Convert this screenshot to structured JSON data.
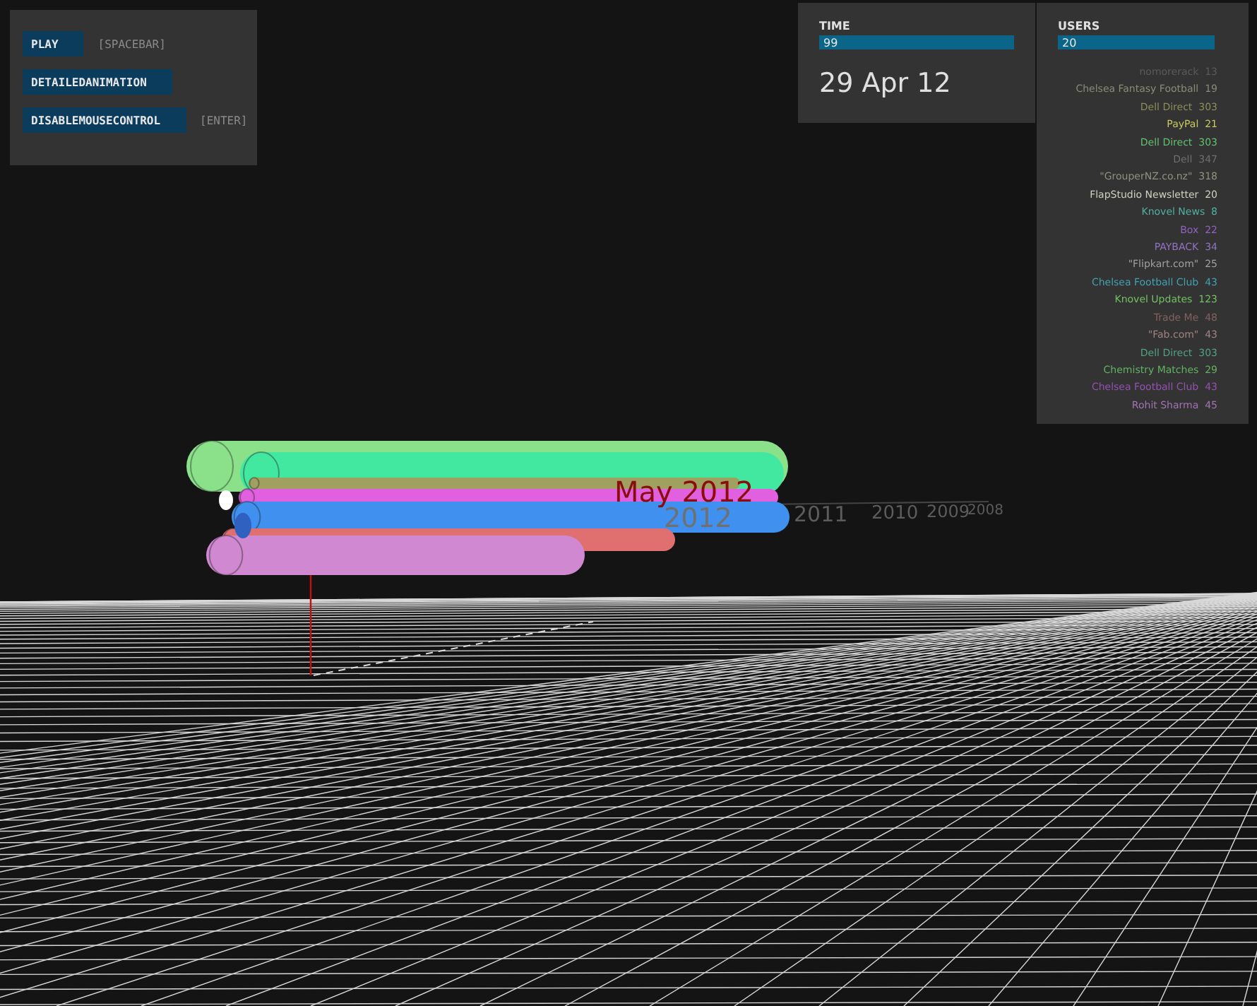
{
  "controls": [
    {
      "label": "PLAY",
      "shortcut": "[SPACEBAR]"
    },
    {
      "label": "DETAILEDANIMATION"
    },
    {
      "label": "DISABLEMOUSECONTROL",
      "shortcut": "[ENTER]"
    }
  ],
  "time": {
    "title": "TIME",
    "value": "99",
    "level": 1,
    "date": "29 Apr 12"
  },
  "users": {
    "title": "USERS",
    "value": "20",
    "level": 1,
    "items": [
      {
        "label": "nomorerack  13",
        "color": "#5a5a5a"
      },
      {
        "label": "Chelsea Fantasy Football  19",
        "color": "#8a8a78"
      },
      {
        "label": "Dell Direct  303",
        "color": "#8c8c5c"
      },
      {
        "label": "PayPal  21",
        "color": "#c8c862"
      },
      {
        "label": "Dell Direct  303",
        "color": "#62c070"
      },
      {
        "label": "Dell  347",
        "color": "#6e6e6e"
      },
      {
        "label": "\"GrouperNZ.co.nz\"  318",
        "color": "#909080"
      },
      {
        "label": "FlapStudio Newsletter  20",
        "color": "#d0d0c0"
      },
      {
        "label": "Knovel News  8",
        "color": "#52b0a0"
      },
      {
        "label": "Box  22",
        "color": "#9262c0"
      },
      {
        "label": "PAYBACK  34",
        "color": "#9272c0"
      },
      {
        "label": "\"Flipkart.com\"  25",
        "color": "#a0a0a0"
      },
      {
        "label": "Chelsea Football Club  43",
        "color": "#42a0b0"
      },
      {
        "label": "Knovel Updates  123",
        "color": "#72c062"
      },
      {
        "label": "Trade Me  48",
        "color": "#806262"
      },
      {
        "label": "\"Fab.com\"  43",
        "color": "#a08282"
      },
      {
        "label": "Dell Direct  303",
        "color": "#52a082"
      },
      {
        "label": "Chemistry Matches  29",
        "color": "#62b062"
      },
      {
        "label": "Chelsea Football Club  43",
        "color": "#9252b0"
      },
      {
        "label": "Rohit Sharma  45",
        "color": "#a272b2"
      }
    ]
  },
  "scene": {
    "current_month": "May 2012",
    "years": [
      "2012",
      "2011",
      "2010",
      "2009",
      "2008"
    ]
  }
}
